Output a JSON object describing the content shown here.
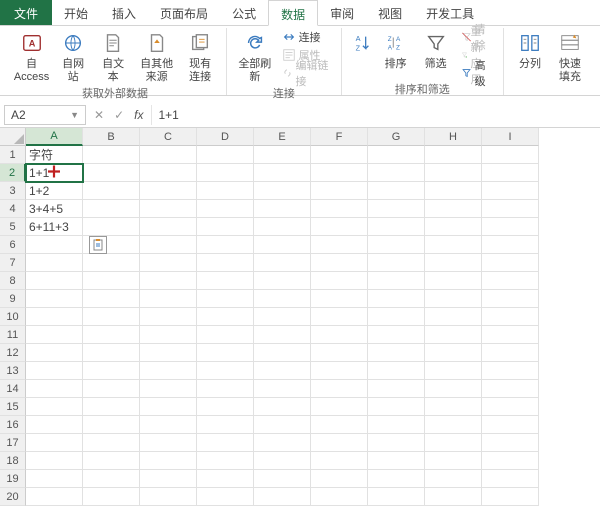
{
  "tabs": {
    "file": "文件",
    "home": "开始",
    "insert": "插入",
    "layout": "页面布局",
    "formulas": "公式",
    "data": "数据",
    "review": "审阅",
    "view": "视图",
    "dev": "开发工具"
  },
  "ribbon": {
    "ext_data": {
      "access": "自 Access",
      "web": "自网站",
      "text": "自文本",
      "other": "自其他来源",
      "existing": "现有连接",
      "label": "获取外部数据"
    },
    "conn": {
      "refresh": "全部刷新",
      "connections": "连接",
      "properties": "属性",
      "editlinks": "编辑链接",
      "label": "连接"
    },
    "sortfilter": {
      "sort": "排序",
      "filter": "筛选",
      "clear": "清除",
      "reapply": "重新应用",
      "advanced": "高级",
      "label": "排序和筛选"
    },
    "tools": {
      "textcols": "分列",
      "flashfill": "快速填充"
    }
  },
  "namebox": "A2",
  "formula": "1+1",
  "columns": [
    "A",
    "B",
    "C",
    "D",
    "E",
    "F",
    "G",
    "H",
    "I"
  ],
  "rows": [
    "1",
    "2",
    "3",
    "4",
    "5",
    "6",
    "7",
    "8",
    "9",
    "10",
    "11",
    "12",
    "13",
    "14",
    "15",
    "16",
    "17",
    "18",
    "19",
    "20"
  ],
  "cells": {
    "A1": "字符",
    "A2": "1+1",
    "A3": "1+2",
    "A4": "3+4+5",
    "A5": "6+11+3"
  },
  "activeCell": "A2",
  "selectedCol": "A",
  "selectedRow": "2"
}
